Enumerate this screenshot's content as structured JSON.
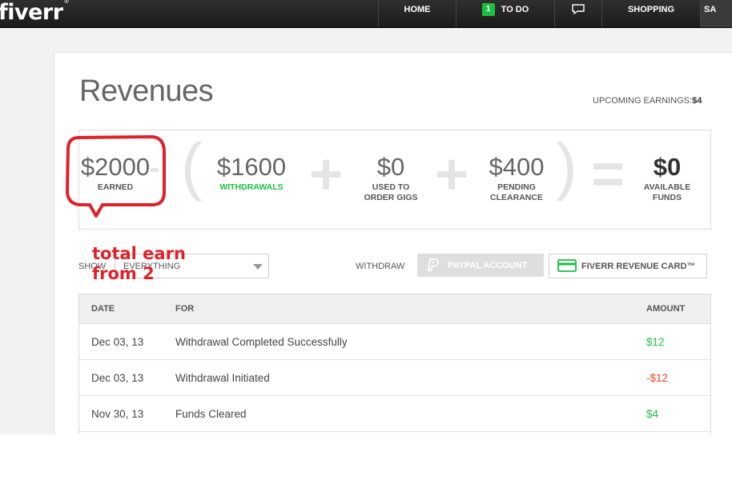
{
  "nav": {
    "logo": "fiverr",
    "logo_mark": "®",
    "items": {
      "home": "HOME",
      "todo_count": "1",
      "todo": "TO DO",
      "shopping": "SHOPPING",
      "partial": "SA"
    }
  },
  "page": {
    "title": "Revenues",
    "upcoming_label": "UPCOMING EARNINGS:",
    "upcoming_value": "$4"
  },
  "summary": {
    "earned": {
      "value": "$2000",
      "label": "EARNED"
    },
    "withdrawals": {
      "value": "$1600",
      "label": "WITHDRAWALS"
    },
    "used": {
      "value": "$0",
      "label_line1": "USED TO",
      "label_line2": "ORDER GIGS"
    },
    "pending": {
      "value": "$400",
      "label_line1": "PENDING",
      "label_line2": "CLEARANCE"
    },
    "available": {
      "value": "$0",
      "label_line1": "AVAILABLE",
      "label_line2": "FUNDS"
    },
    "ops": {
      "minus": "-",
      "open": "(",
      "plus": "+",
      "close": ")",
      "equals": "="
    }
  },
  "controls": {
    "show_label": "SHOW",
    "filter_value": "EVERYTHING",
    "withdraw_label": "WITHDRAW",
    "paypal_button": "PAYPAL ACCOUNT",
    "revenue_card_button": "FIVERR REVENUE CARD™"
  },
  "table": {
    "headers": {
      "date": "DATE",
      "for": "FOR",
      "amount": "AMOUNT"
    },
    "rows": [
      {
        "date": "Dec 03, 13",
        "for": "Withdrawal Completed Successfully",
        "amount": "$12"
      },
      {
        "date": "Dec 03, 13",
        "for": "Withdrawal Initiated",
        "amount": "-$12"
      },
      {
        "date": "Nov 30, 13",
        "for": "Funds Cleared",
        "amount": "$4"
      }
    ]
  },
  "annotation": {
    "line1": "total earn",
    "line2": "from 2",
    "color": "#e0212a"
  },
  "colors": {
    "brand_green": "#1dbf40",
    "negative_red": "#e8452c",
    "nav_bg": "#1f1f1f"
  }
}
